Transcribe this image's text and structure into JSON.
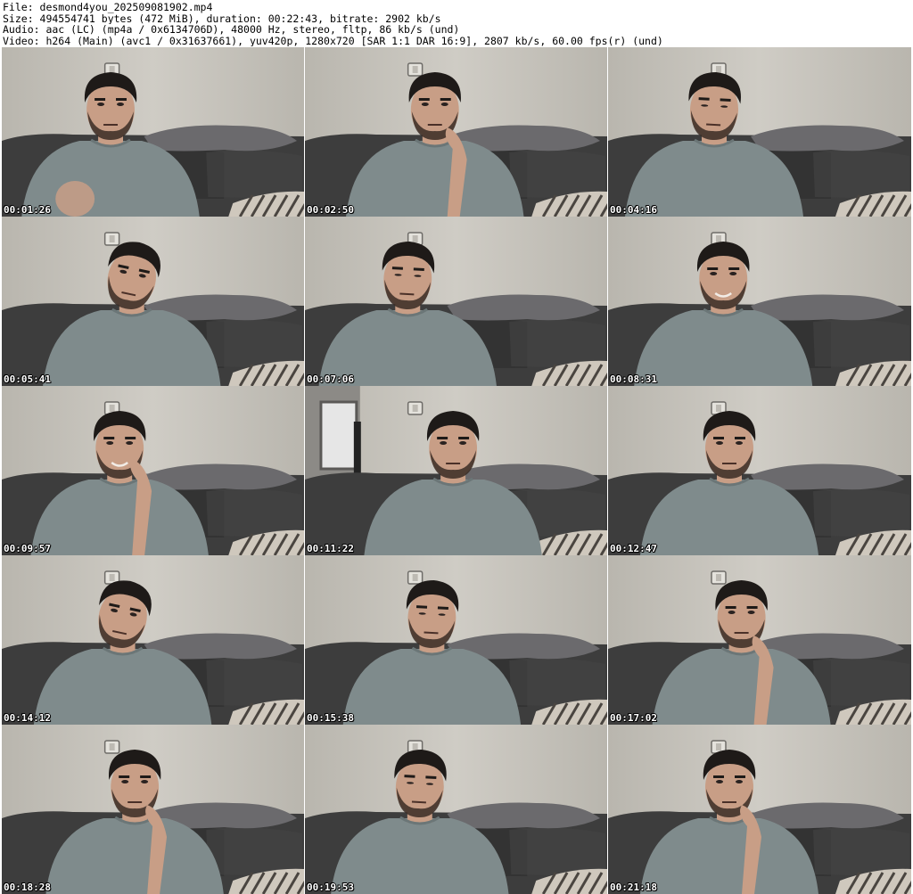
{
  "header": {
    "file_line": "File: desmond4you_202509081902.mp4",
    "size_line": "Size: 494554741 bytes (472 MiB), duration: 00:22:43, bitrate: 2902 kb/s",
    "audio_line": "Audio: aac (LC) (mp4a / 0x6134706D), 48000 Hz, stereo, fltp, 86 kb/s (und)",
    "video_line": "Video: h264 (Main) (avc1 / 0x31637661), yuv420p, 1280x720 [SAR 1:1 DAR 16:9], 2807 kb/s, 60.00 fps(r) (und)"
  },
  "thumbnails": [
    {
      "timestamp": "00:01:26",
      "pose": "hand-raised",
      "face_x": 0.36,
      "hand": "left-low"
    },
    {
      "timestamp": "00:02:50",
      "pose": "hand-chin",
      "face_x": 0.43,
      "hand": "right-chin"
    },
    {
      "timestamp": "00:04:16",
      "pose": "looking-down",
      "face_x": 0.35,
      "hand": "none"
    },
    {
      "timestamp": "00:05:41",
      "pose": "tilted",
      "face_x": 0.43,
      "hand": "none"
    },
    {
      "timestamp": "00:07:06",
      "pose": "looking-down",
      "face_x": 0.34,
      "hand": "none"
    },
    {
      "timestamp": "00:08:31",
      "pose": "smiling",
      "face_x": 0.38,
      "hand": "none"
    },
    {
      "timestamp": "00:09:57",
      "pose": "hand-cheek",
      "face_x": 0.39,
      "hand": "right-cheek"
    },
    {
      "timestamp": "00:11:22",
      "pose": "forward",
      "face_x": 0.49,
      "hand": "none",
      "window": true
    },
    {
      "timestamp": "00:12:47",
      "pose": "forward",
      "face_x": 0.4,
      "hand": "none"
    },
    {
      "timestamp": "00:14:12",
      "pose": "tilted",
      "face_x": 0.4,
      "hand": "none"
    },
    {
      "timestamp": "00:15:38",
      "pose": "looking-down",
      "face_x": 0.42,
      "hand": "none"
    },
    {
      "timestamp": "00:17:02",
      "pose": "hand-chin",
      "face_x": 0.44,
      "hand": "right-chin"
    },
    {
      "timestamp": "00:18:28",
      "pose": "hand-chin",
      "face_x": 0.44,
      "hand": "right-chin"
    },
    {
      "timestamp": "00:19:53",
      "pose": "looking-down",
      "face_x": 0.38,
      "hand": "none"
    },
    {
      "timestamp": "00:21:18",
      "pose": "hand-chin",
      "face_x": 0.4,
      "hand": "right-chin"
    }
  ],
  "colors": {
    "wall": "#b9b6ae",
    "wall_light": "#cfccc5",
    "sofa": "#3d3d3d",
    "sofa_dark": "#2a2a2a",
    "pillow": "#6b6a6d",
    "shirt": "#7f8b8c",
    "skin": "#c89e86",
    "hair": "#1e1a18",
    "timestamp_text": "#ffffff"
  }
}
